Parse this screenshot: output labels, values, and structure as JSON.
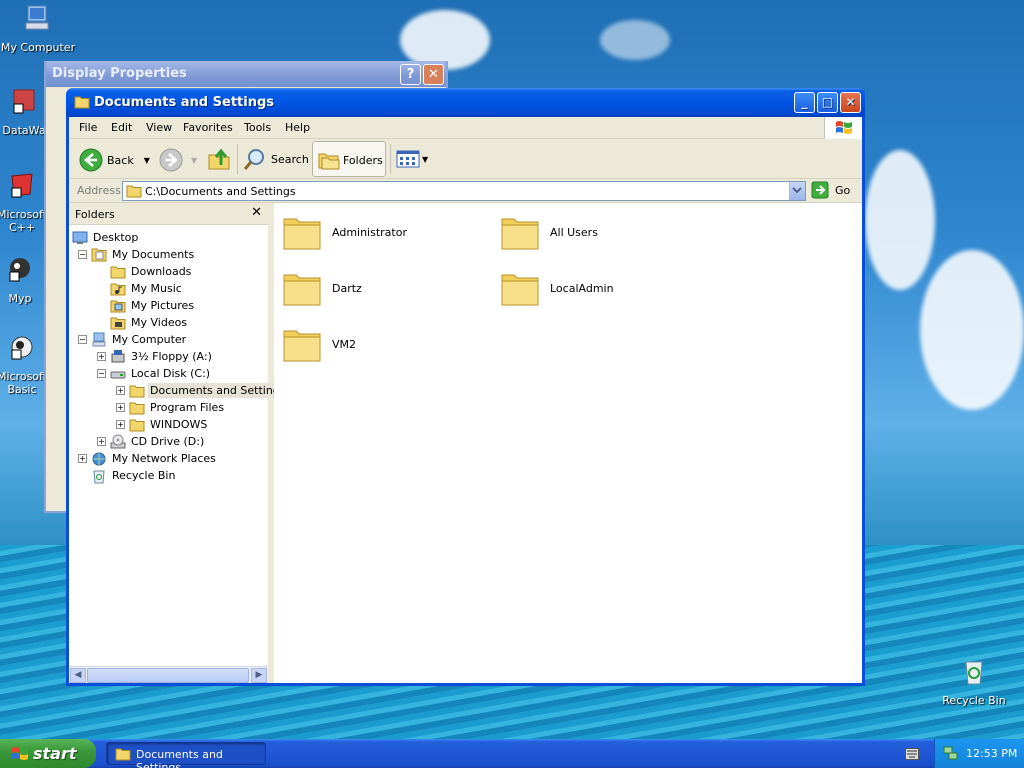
{
  "desktop": {
    "icons": [
      {
        "label": "My Computer"
      },
      {
        "label": "DataWa"
      },
      {
        "label": "Microsoft C++"
      },
      {
        "label": "Myp"
      },
      {
        "label": "Microsoft Basic"
      },
      {
        "label": "Recycle Bin"
      }
    ]
  },
  "background_window": {
    "title": "Display Properties",
    "help_label": "?",
    "close_label": "✕"
  },
  "window": {
    "title": "Documents and Settings",
    "controls": {
      "minimize": "_",
      "maximize": "□",
      "close": "✕"
    },
    "menu": [
      "File",
      "Edit",
      "View",
      "Favorites",
      "Tools",
      "Help"
    ],
    "toolbar": {
      "back_label": "Back",
      "search_label": "Search",
      "folders_label": "Folders"
    },
    "address": {
      "label": "Address",
      "value": "C:\\Documents and Settings",
      "go_label": "Go"
    },
    "folders_pane": {
      "title": "Folders",
      "close_label": "✕",
      "tree": [
        {
          "label": "Desktop",
          "level": 0,
          "expander": "",
          "icon": "desktop-icon"
        },
        {
          "label": "My Documents",
          "level": 1,
          "expander": "−",
          "icon": "my-documents-icon"
        },
        {
          "label": "Downloads",
          "level": 2,
          "expander": "",
          "icon": "folder-icon"
        },
        {
          "label": "My Music",
          "level": 2,
          "expander": "",
          "icon": "music-folder-icon"
        },
        {
          "label": "My Pictures",
          "level": 2,
          "expander": "",
          "icon": "pictures-folder-icon"
        },
        {
          "label": "My Videos",
          "level": 2,
          "expander": "",
          "icon": "videos-folder-icon"
        },
        {
          "label": "My Computer",
          "level": 1,
          "expander": "−",
          "icon": "computer-icon"
        },
        {
          "label": "3½ Floppy (A:)",
          "level": 2,
          "expander": "+",
          "icon": "floppy-icon"
        },
        {
          "label": "Local Disk (C:)",
          "level": 2,
          "expander": "−",
          "icon": "hard-disk-icon"
        },
        {
          "label": "Documents and Settings",
          "level": 3,
          "expander": "+",
          "icon": "folder-icon",
          "selected": true
        },
        {
          "label": "Program Files",
          "level": 3,
          "expander": "+",
          "icon": "folder-icon"
        },
        {
          "label": "WINDOWS",
          "level": 3,
          "expander": "+",
          "icon": "folder-icon"
        },
        {
          "label": "CD Drive (D:)",
          "level": 2,
          "expander": "+",
          "icon": "cd-drive-icon"
        },
        {
          "label": "My Network Places",
          "level": 1,
          "expander": "+",
          "icon": "network-icon"
        },
        {
          "label": "Recycle Bin",
          "level": 1,
          "expander": "",
          "icon": "recycle-bin-icon"
        }
      ]
    },
    "content": {
      "items": [
        {
          "label": "Administrator"
        },
        {
          "label": "All Users"
        },
        {
          "label": "Dartz"
        },
        {
          "label": "LocalAdmin"
        },
        {
          "label": "VM2"
        }
      ]
    }
  },
  "taskbar": {
    "start_label": "start",
    "task_label": "Documents and Settings",
    "clock": "12:53 PM"
  }
}
